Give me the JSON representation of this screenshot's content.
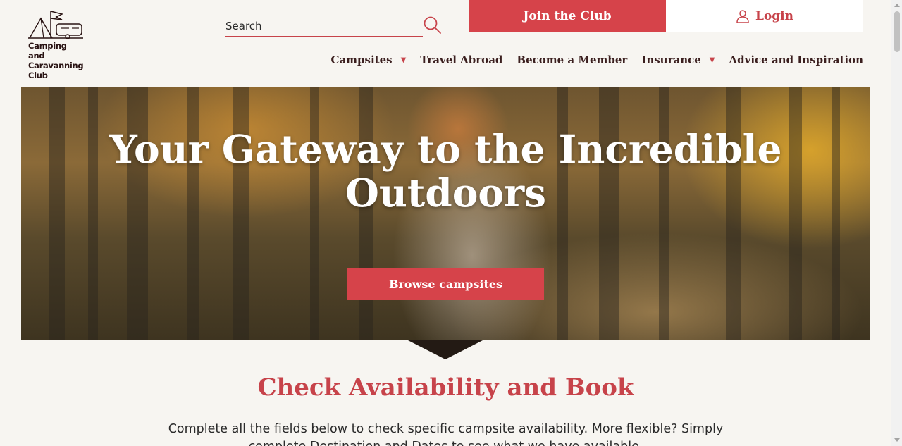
{
  "logo": {
    "line1": "Camping and",
    "line2": "Caravanning",
    "line3": "Club",
    "icon": "tent-caravan-logo-icon"
  },
  "search": {
    "placeholder": "Search",
    "icon": "search-icon"
  },
  "header": {
    "join_label": "Join the Club",
    "login_label": "Login",
    "login_icon": "user-icon"
  },
  "nav": {
    "items": [
      {
        "label": "Campsites",
        "has_dropdown": true
      },
      {
        "label": "Travel Abroad",
        "has_dropdown": false
      },
      {
        "label": "Become a Member",
        "has_dropdown": false
      },
      {
        "label": "Insurance",
        "has_dropdown": true
      },
      {
        "label": "Advice and Inspiration",
        "has_dropdown": false
      }
    ],
    "caret": "▼"
  },
  "hero": {
    "title": "Your Gateway to the Incredible Outdoors",
    "cta_label": "Browse campsites"
  },
  "availability": {
    "title": "Check Availability and Book",
    "description": "Complete all the fields below to check specific campsite availability. More flexible? Simply complete Destination and Dates to see what we have available."
  },
  "colors": {
    "accent": "#d6434a",
    "text_dark": "#3b1f1f",
    "background": "#f7f5f1"
  }
}
